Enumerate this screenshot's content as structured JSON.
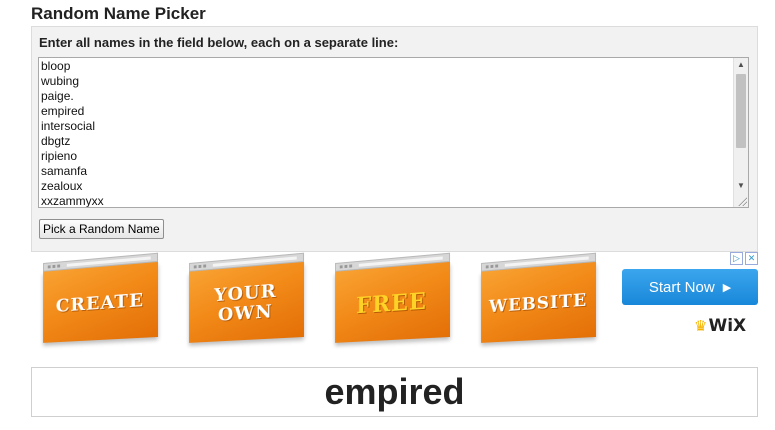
{
  "page": {
    "title": "Random Name Picker"
  },
  "form": {
    "instruction": "Enter all names in the field below, each on a separate line:",
    "names": [
      "bloop",
      "wubing",
      "paige.",
      "empired",
      "intersocial",
      "dbgtz",
      "ripieno",
      "samanfa",
      "zealoux",
      "xxzammyxx"
    ],
    "button_label": "Pick a Random Name"
  },
  "ad": {
    "cards": [
      {
        "text": "CREATE",
        "color": "#ffffff"
      },
      {
        "text": "YOUR OWN",
        "color": "#ffffff"
      },
      {
        "text": "FREE",
        "color": "#ffd227"
      },
      {
        "text": "WEBSITE",
        "color": "#ffffff"
      }
    ],
    "cta_label": "Start Now",
    "brand": "WiX",
    "accent": "#f28a18",
    "cta_color": "#1e8fe0"
  },
  "result": {
    "name": "empired"
  }
}
